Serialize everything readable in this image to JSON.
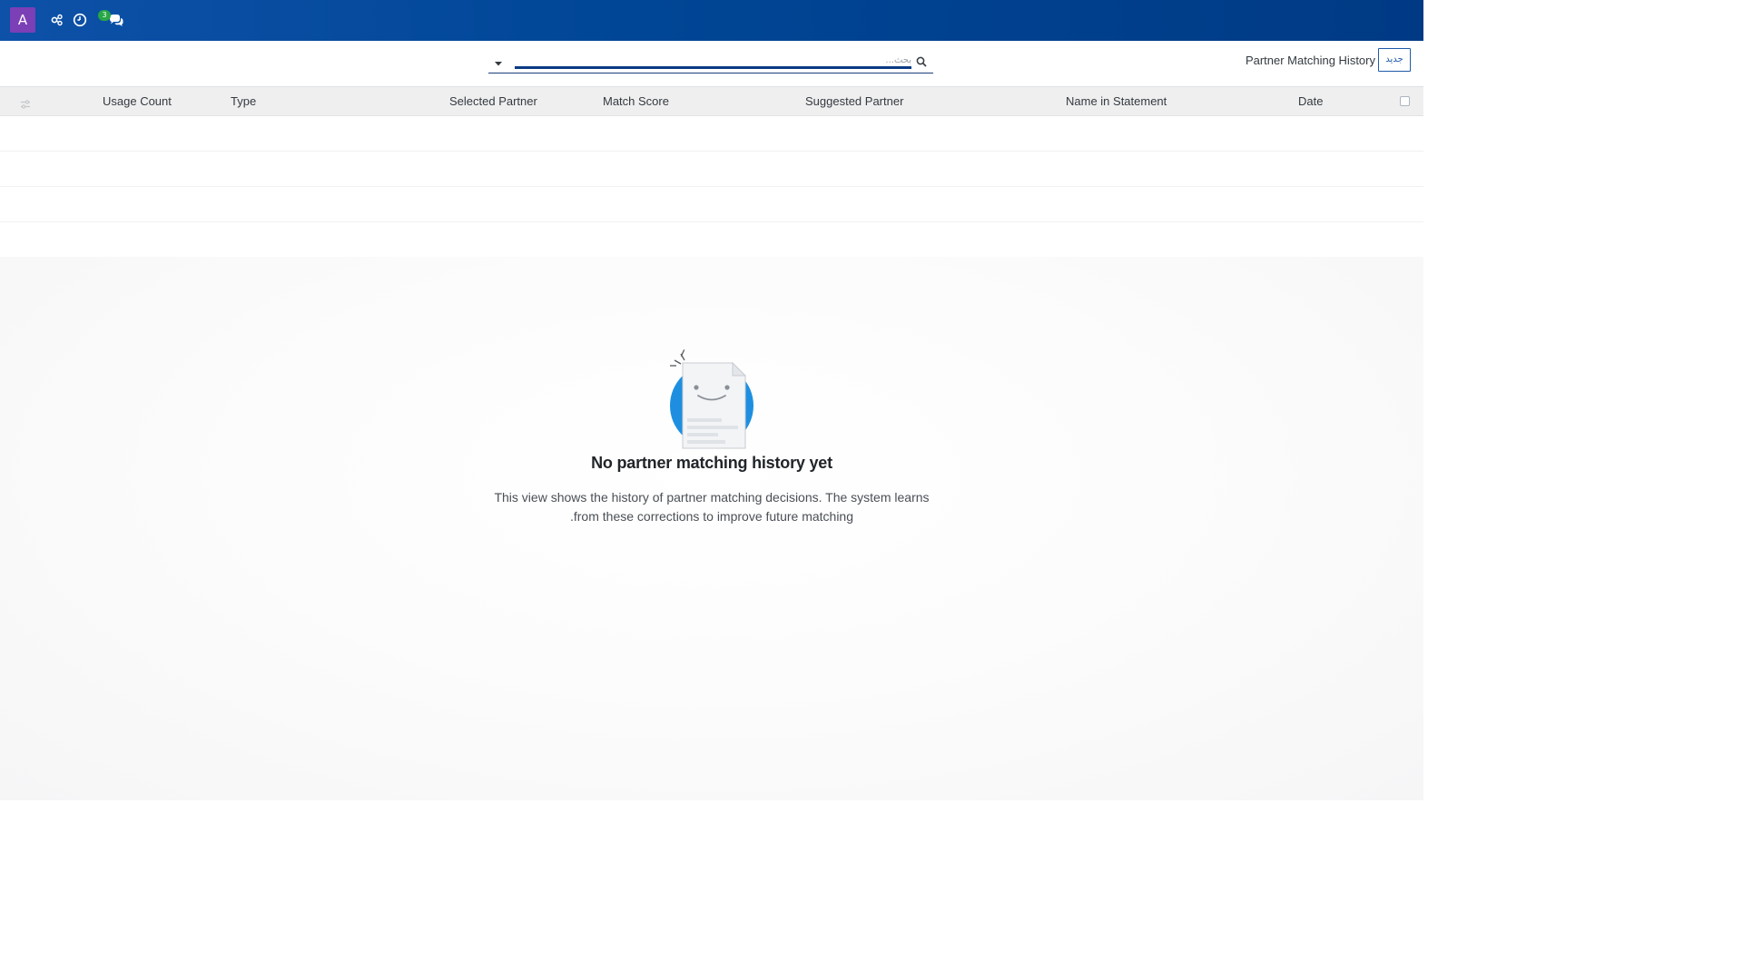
{
  "navbar": {
    "avatar_letter": "A",
    "messages_badge": "3",
    "icons": [
      "tools-icon",
      "clock-icon",
      "chat-icon"
    ]
  },
  "control_panel": {
    "new_button_label": "جديد",
    "breadcrumb_title": "Partner Matching History",
    "search": {
      "placeholder": "بحث...",
      "value": ""
    }
  },
  "list": {
    "columns": {
      "date": "Date",
      "name_in_statement": "Name in Statement",
      "suggested_partner": "Suggested Partner",
      "match_score": "Match Score",
      "selected_partner": "Selected Partner",
      "type": "Type",
      "usage_count": "Usage Count"
    },
    "rows": []
  },
  "help": {
    "title": "No partner matching history yet",
    "line1": "This view shows the history of partner matching decisions. The system learns",
    "line2": ".from these corrections to improve future matching"
  },
  "colors": {
    "navbar_start": "#0d51a8",
    "navbar_end": "#003a85",
    "avatar": "#7b3fb6",
    "badge": "#28a745",
    "accent": "#1e5aa8"
  }
}
